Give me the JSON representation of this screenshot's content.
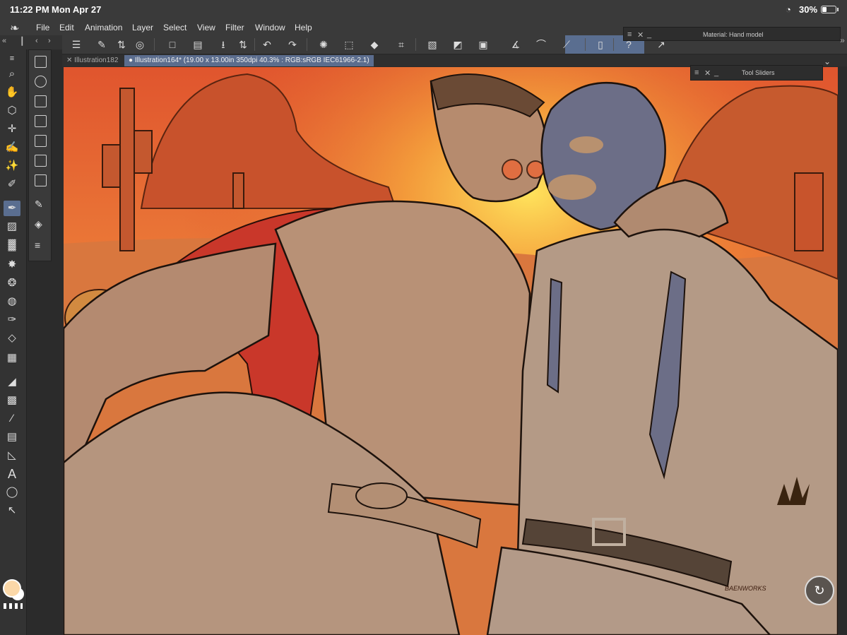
{
  "status": {
    "time": "11:22 PM",
    "date": "Mon Apr 27",
    "battery": "30%"
  },
  "menu": {
    "items": [
      "File",
      "Edit",
      "Animation",
      "Layer",
      "Select",
      "View",
      "Filter",
      "Window",
      "Help"
    ]
  },
  "tabs": [
    {
      "label": "Illustration182"
    },
    {
      "label": "Illustration164* (19.00 x 13.00in 350dpi 40.3% : RGB:sRGB IEC61966-2.1)"
    }
  ],
  "panels": {
    "material": "Material: Hand model",
    "sliders": "Tool Sliders"
  },
  "canvas": {
    "signature": "BAENWORKS"
  },
  "colors": {
    "main_color": "#fbd8a8",
    "ui_accent": "#5a6e90",
    "sky_top": "#e0552e",
    "sun": "#ffe45c"
  }
}
